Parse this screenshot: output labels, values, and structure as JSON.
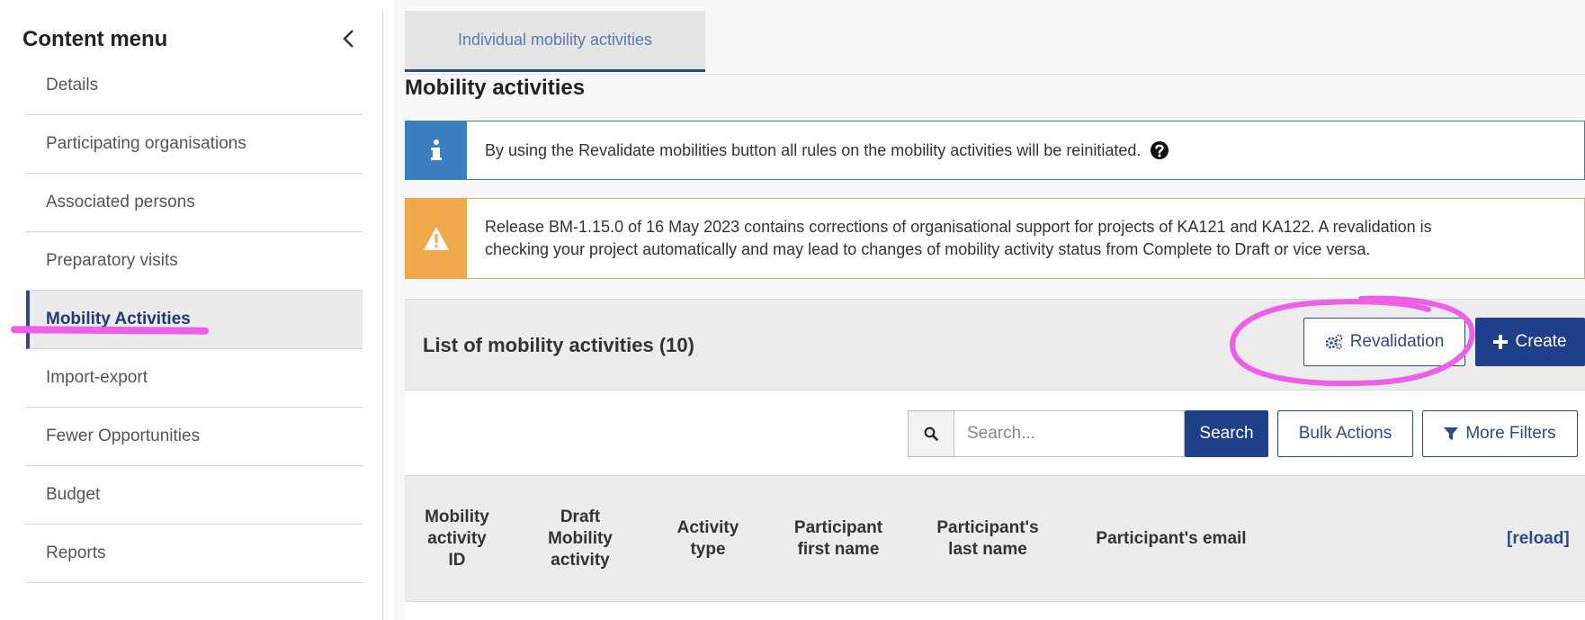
{
  "sidebar": {
    "title": "Content menu",
    "items": [
      {
        "label": "Details"
      },
      {
        "label": "Participating organisations"
      },
      {
        "label": "Associated persons"
      },
      {
        "label": "Preparatory visits"
      },
      {
        "label": "Mobility Activities",
        "active": true
      },
      {
        "label": "Import-export"
      },
      {
        "label": "Fewer Opportunities"
      },
      {
        "label": "Budget"
      },
      {
        "label": "Reports"
      }
    ],
    "collapse_icon": "chevron-left-icon"
  },
  "tabs": [
    {
      "label": "Individual mobility activities",
      "active": true
    }
  ],
  "main": {
    "section_title": "Mobility activities",
    "info_alert": {
      "icon": "info-icon",
      "text": "By using the Revalidate mobilities button all rules on the mobility activities will be reinitiated.",
      "help_icon": "question-circle-icon"
    },
    "warning_alert": {
      "icon": "warning-triangle-icon",
      "line1": "Release BM-1.15.0 of 16 May 2023 contains corrections of organisational support for projects of KA121 and KA122. A revalidation is",
      "line2": "checking your project automatically and may lead to changes of mobility activity status from Complete to Draft or vice versa."
    },
    "list": {
      "title": "List of mobility activities (10)",
      "revalidation_label": "Revalidation",
      "create_label": "Create"
    },
    "toolbar": {
      "search_placeholder": "Search...",
      "search_label": "Search",
      "bulk_actions_label": "Bulk Actions",
      "more_filters_label": "More Filters"
    },
    "table": {
      "columns": [
        {
          "l1": "Mobility",
          "l2": "activity",
          "l3": "ID"
        },
        {
          "l1": "Draft",
          "l2": "Mobility",
          "l3": "activity"
        },
        {
          "l1": "Activity",
          "l2": "type",
          "l3": ""
        },
        {
          "l1": "Participant",
          "l2": "first name",
          "l3": ""
        },
        {
          "l1": "Participant's",
          "l2": "last name",
          "l3": ""
        },
        {
          "l1": "Participant's email",
          "l2": "",
          "l3": ""
        }
      ],
      "reload_label": "[reload]"
    }
  },
  "colors": {
    "primary": "#1f3f8a",
    "info": "#3c7fc0",
    "warning": "#efa84a",
    "annotation": "#ee5ee9"
  }
}
